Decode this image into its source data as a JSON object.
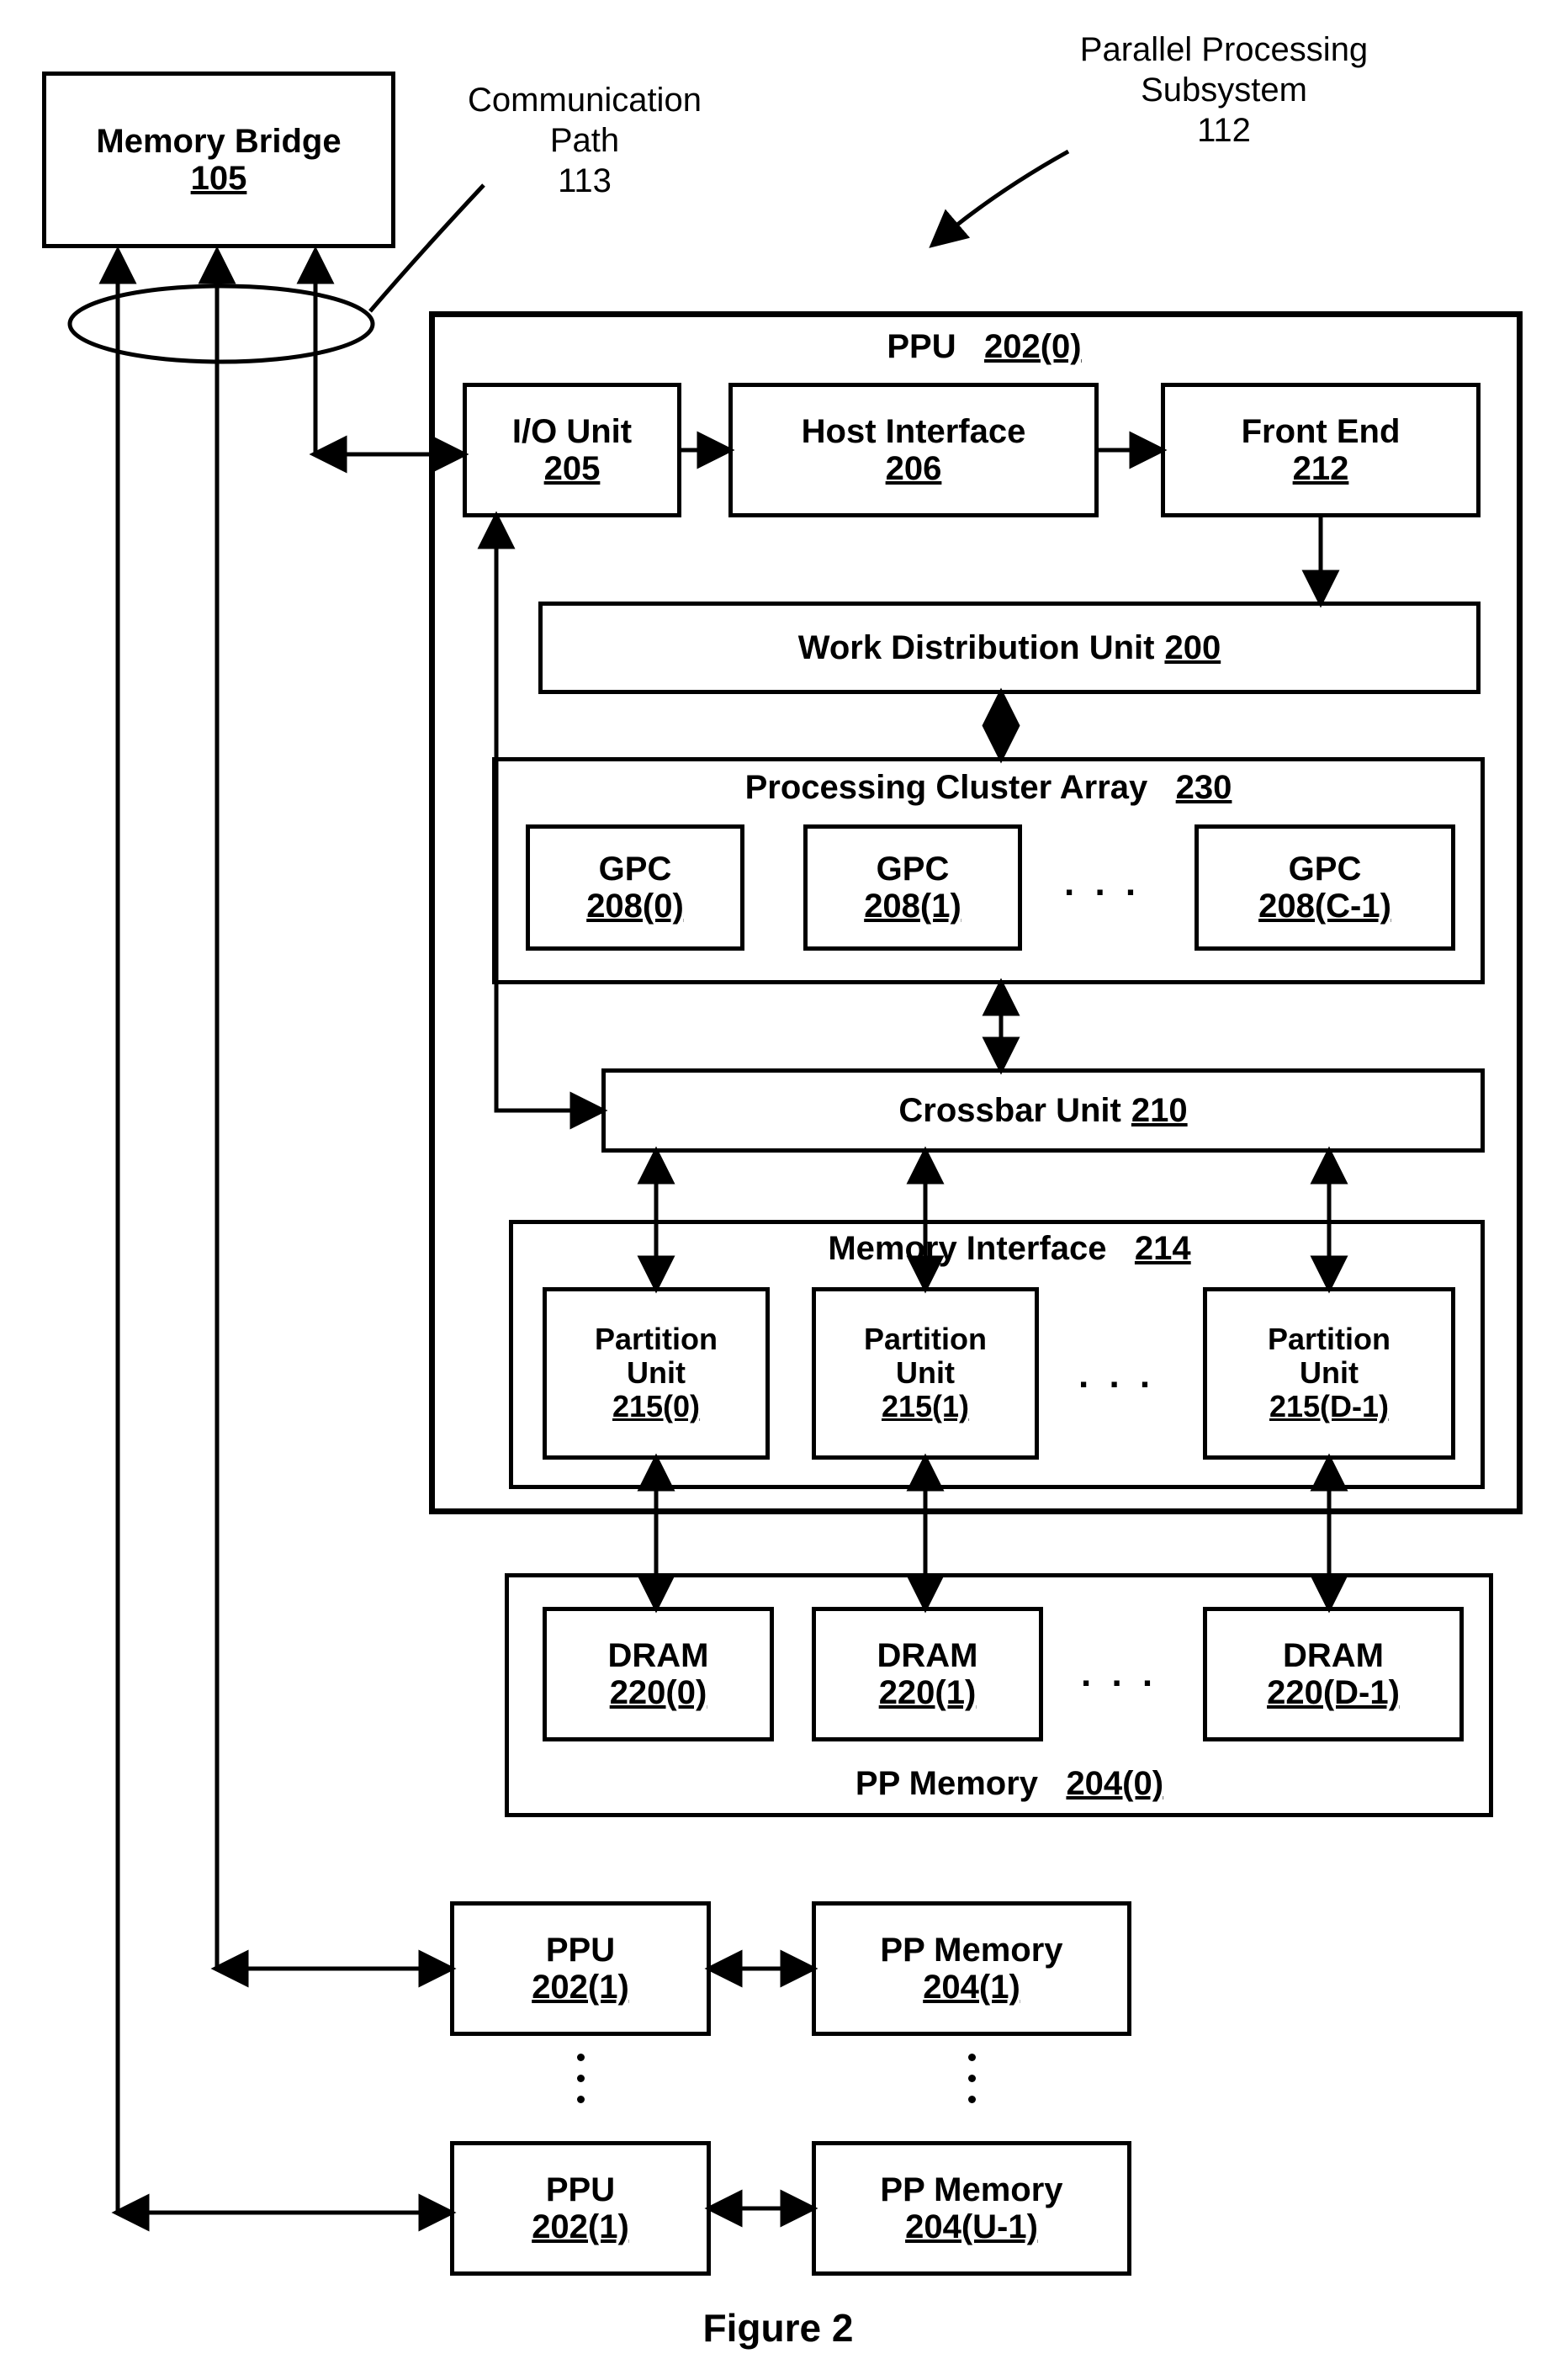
{
  "top": {
    "memory_bridge": {
      "title": "Memory Bridge",
      "id": "105"
    },
    "comm_path": {
      "label": "Communication\nPath",
      "id": "113"
    },
    "subsystem": {
      "label": "Parallel Processing\nSubsystem",
      "id": "112"
    }
  },
  "ppu0": {
    "title": "PPU",
    "id": "202(0)",
    "io": {
      "title": "I/O Unit",
      "id": "205"
    },
    "host": {
      "title": "Host Interface",
      "id": "206"
    },
    "front": {
      "title": "Front End",
      "id": "212"
    },
    "wdu": {
      "title": "Work Distribution Unit",
      "id": "200"
    },
    "pca": {
      "title": "Processing Cluster Array",
      "id": "230",
      "gpc0": {
        "title": "GPC",
        "id": "208(0)"
      },
      "gpc1": {
        "title": "GPC",
        "id": "208(1)"
      },
      "gpcN": {
        "title": "GPC",
        "id": "208(C-1)"
      }
    },
    "xbar": {
      "title": "Crossbar Unit",
      "id": "210"
    },
    "mif": {
      "title": "Memory Interface",
      "id": "214",
      "p0": {
        "title": "Partition\nUnit",
        "id": "215(0)"
      },
      "p1": {
        "title": "Partition\nUnit",
        "id": "215(1)"
      },
      "pN": {
        "title": "Partition\nUnit",
        "id": "215(D-1)"
      }
    }
  },
  "ppmem0": {
    "title": "PP Memory",
    "id": "204(0)",
    "d0": {
      "title": "DRAM",
      "id": "220(0)"
    },
    "d1": {
      "title": "DRAM",
      "id": "220(1)"
    },
    "dN": {
      "title": "DRAM",
      "id": "220(D-1)"
    }
  },
  "extra": {
    "ppu1": {
      "title": "PPU",
      "id": "202(1)"
    },
    "mem1": {
      "title": "PP Memory",
      "id": "204(1)"
    },
    "ppuU": {
      "title": "PPU",
      "id": "202(1)"
    },
    "memU": {
      "title": "PP Memory",
      "id": "204(U-1)"
    }
  },
  "figure": "Figure 2",
  "dots": ". . ."
}
